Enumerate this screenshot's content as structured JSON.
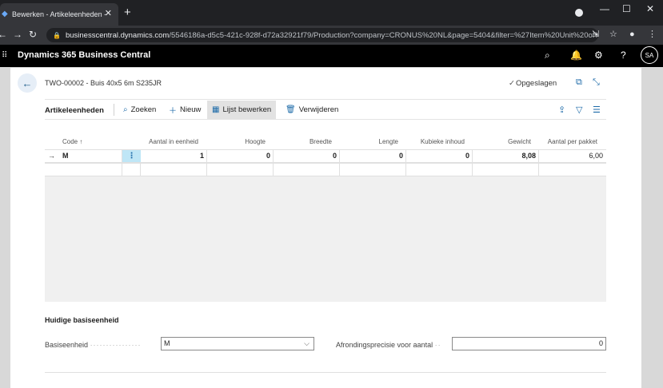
{
  "browser": {
    "tab_title": "Bewerken - Artikeleenheden - TV",
    "tab_close": "✕",
    "new_tab": "+",
    "url_host": "businesscentral.dynamics.com",
    "url_path": "/5546186a-d5c5-421c-928f-d72a32921f79/Production?company=CRONUS%20NL&page=5404&filter=%27Item%20Unit%20of%20..."
  },
  "app": {
    "name": "Dynamics 365 Business Central",
    "avatar_initials": "SA"
  },
  "page": {
    "title": "TWO-00002 - Buis 40x5 6m S235JR",
    "saved_label": "Opgeslagen"
  },
  "actionbar": {
    "part_title": "Artikeleenheden",
    "search": "Zoeken",
    "new": "Nieuw",
    "edit_list": "Lijst bewerken",
    "delete": "Verwijderen"
  },
  "grid": {
    "columns": [
      "Code ↑",
      "Aantal in eenheid",
      "Hoogte",
      "Breedte",
      "Lengte",
      "Kubieke inhoud",
      "Gewicht",
      "Aantal per pakket"
    ],
    "rows": [
      {
        "code": "M",
        "qty": "1",
        "height": "0",
        "width": "0",
        "length": "0",
        "cubage": "0",
        "weight": "8,08",
        "per_package": "6,00"
      }
    ]
  },
  "fasttab": {
    "title": "Huidige basiseenheid",
    "base_unit_label": "Basiseenheid",
    "base_unit_value": "M",
    "rounding_label": "Afrondingsprecisie voor aantal",
    "rounding_value": "0"
  }
}
